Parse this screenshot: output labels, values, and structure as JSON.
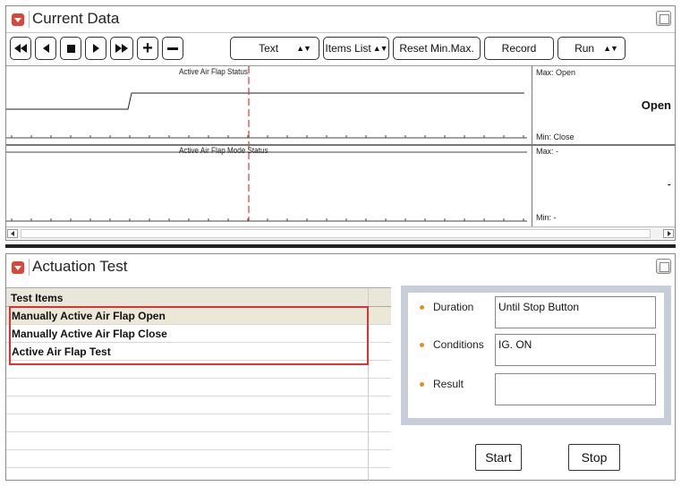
{
  "current_data": {
    "title": "Current Data",
    "toolbar": {
      "text_select": "Text",
      "items_list": "Items List",
      "reset": "Reset Min.Max.",
      "record": "Record",
      "run_select": "Run"
    },
    "graphs": [
      {
        "title": "Active Air Flap Status",
        "max": "Max: Open",
        "min": "Min:  Close",
        "value": "Open"
      },
      {
        "title": "Active Air Flap Mode Status",
        "max": "Max: -",
        "min": "Min:  -",
        "value": "-"
      }
    ]
  },
  "actuation_test": {
    "title": "Actuation Test",
    "grid_header": "Test Items",
    "items": [
      "Manually Active Air Flap Open",
      "Manually Active Air Flap Close",
      "Active Air Flap Test"
    ],
    "fields": {
      "duration_label": "Duration",
      "duration_value": "Until Stop Button",
      "conditions_label": "Conditions",
      "conditions_value": "IG. ON",
      "result_label": "Result",
      "result_value": ""
    },
    "start_label": "Start",
    "stop_label": "Stop"
  },
  "colors": {
    "accent_red": "#d9473b",
    "highlight_red": "#e03030",
    "bullet_orange": "#e0902a",
    "info_frame": "#c8ced9"
  }
}
